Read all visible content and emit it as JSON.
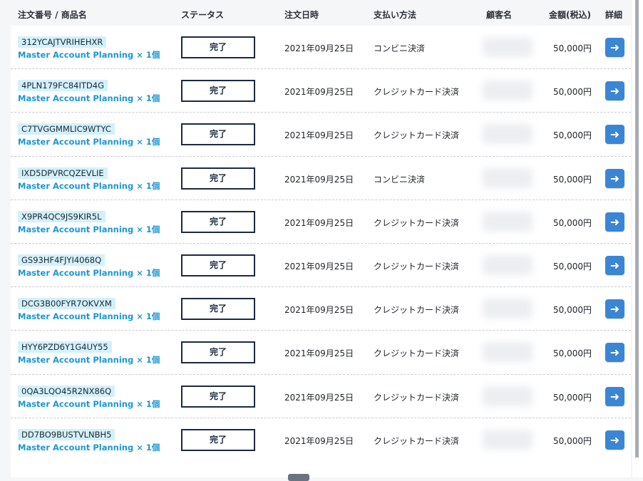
{
  "table": {
    "headers": {
      "order": "注文番号 / 商品名",
      "status": "ステータス",
      "date": "注文日時",
      "payment": "支払い方法",
      "customer": "顧客名",
      "amount": "金額(税込)",
      "detail": "詳細"
    },
    "rows": [
      {
        "order_id": "312YCAJTVRIHEHXR",
        "product": "Master Account Planning × 1個",
        "status": "完了",
        "date": "2021年09月25日",
        "payment": "コンビニ決済",
        "amount": "50,000円"
      },
      {
        "order_id": "4PLN179FC84ITD4G",
        "product": "Master Account Planning × 1個",
        "status": "完了",
        "date": "2021年09月25日",
        "payment": "クレジットカード決済",
        "amount": "50,000円"
      },
      {
        "order_id": "C7TVGGMMLIC9WTYC",
        "product": "Master Account Planning × 1個",
        "status": "完了",
        "date": "2021年09月25日",
        "payment": "クレジットカード決済",
        "amount": "50,000円"
      },
      {
        "order_id": "IXD5DPVRCQZEVLIE",
        "product": "Master Account Planning × 1個",
        "status": "完了",
        "date": "2021年09月25日",
        "payment": "コンビニ決済",
        "amount": "50,000円"
      },
      {
        "order_id": "X9PR4QC9JS9KIR5L",
        "product": "Master Account Planning × 1個",
        "status": "完了",
        "date": "2021年09月25日",
        "payment": "クレジットカード決済",
        "amount": "50,000円"
      },
      {
        "order_id": "GS93HF4FJYI4068Q",
        "product": "Master Account Planning × 1個",
        "status": "完了",
        "date": "2021年09月25日",
        "payment": "クレジットカード決済",
        "amount": "50,000円"
      },
      {
        "order_id": "DCG3B00FYR7OKVXM",
        "product": "Master Account Planning × 1個",
        "status": "完了",
        "date": "2021年09月25日",
        "payment": "クレジットカード決済",
        "amount": "50,000円"
      },
      {
        "order_id": "HYY6PZD6Y1G4UY55",
        "product": "Master Account Planning × 1個",
        "status": "完了",
        "date": "2021年09月25日",
        "payment": "クレジットカード決済",
        "amount": "50,000円"
      },
      {
        "order_id": "0QA3LQO45R2NX86Q",
        "product": "Master Account Planning × 1個",
        "status": "完了",
        "date": "2021年09月25日",
        "payment": "クレジットカード決済",
        "amount": "50,000円"
      },
      {
        "order_id": "DD7BO9BUSTVLNBH5",
        "product": "Master Account Planning × 1個",
        "status": "完了",
        "date": "2021年09月25日",
        "payment": "クレジットカード決済",
        "amount": "50,000円"
      }
    ]
  },
  "icons": {
    "detail": "arrow-right-icon"
  },
  "colors": {
    "accent": "#3a86d4",
    "id_tag_bg": "#d3f1fb",
    "product_text": "#1c97d4",
    "status_border": "#1b2a40"
  }
}
